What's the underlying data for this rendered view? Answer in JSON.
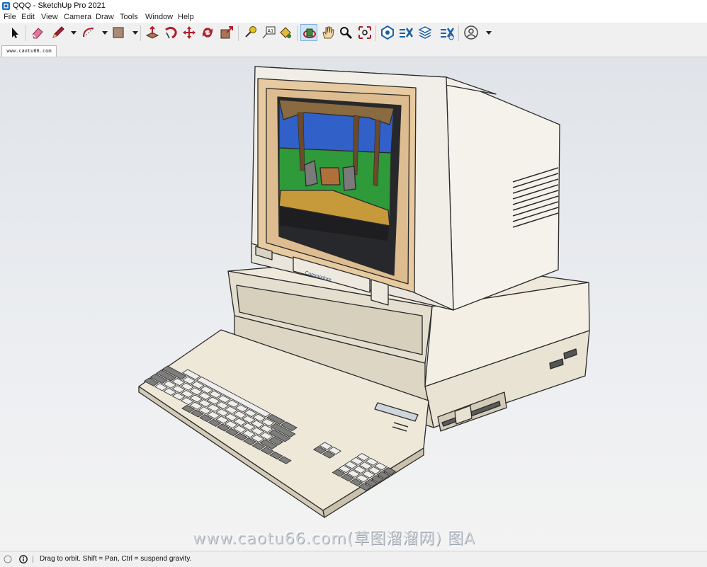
{
  "window": {
    "title": "QQQ - SketchUp Pro 2021"
  },
  "menu": [
    "File",
    "Edit",
    "View",
    "Camera",
    "Draw",
    "Tools",
    "Window",
    "Help"
  ],
  "toolbar": {
    "tools": [
      {
        "name": "select-tool",
        "icon": "arrow-icon"
      },
      {
        "name": "eraser-tool",
        "icon": "eraser-icon"
      },
      {
        "name": "pencil-tool",
        "icon": "pencil-icon"
      },
      {
        "name": "arc-tool",
        "icon": "arc-icon"
      },
      {
        "name": "shape-tool",
        "icon": "rectangle-icon"
      },
      {
        "name": "push-pull-tool",
        "icon": "push-pull-icon"
      },
      {
        "name": "follow-me-tool",
        "icon": "follow-me-icon"
      },
      {
        "name": "move-tool",
        "icon": "move-icon"
      },
      {
        "name": "rotate-tool",
        "icon": "rotate-icon"
      },
      {
        "name": "scale-tool",
        "icon": "scale-icon"
      },
      {
        "name": "tape-measure-tool",
        "icon": "tape-measure-icon"
      },
      {
        "name": "text-tool",
        "icon": "text-icon",
        "label": "A1"
      },
      {
        "name": "paint-bucket-tool",
        "icon": "paint-bucket-icon"
      },
      {
        "name": "orbit-tool",
        "icon": "orbit-icon",
        "active": true
      },
      {
        "name": "pan-tool",
        "icon": "hand-icon"
      },
      {
        "name": "zoom-tool",
        "icon": "magnifier-icon"
      },
      {
        "name": "zoom-extents-tool",
        "icon": "zoom-extents-icon"
      },
      {
        "name": "warehouse-tool",
        "icon": "warehouse-icon"
      },
      {
        "name": "extension-warehouse-tool",
        "icon": "extension-icon"
      },
      {
        "name": "layout-tool",
        "icon": "layers-icon"
      },
      {
        "name": "extension-manager-tool",
        "icon": "extension-manager-icon"
      },
      {
        "name": "account-tool",
        "icon": "account-icon"
      }
    ]
  },
  "scene_tab": {
    "label": "www.caotu66.com"
  },
  "model": {
    "description": "Commodore personal computer 3D model",
    "monitor_brand": "Commodore",
    "colors": {
      "case": "#ebe5d7",
      "case_shadow": "#d6cfbd",
      "bezel": "#e6c89a",
      "screen": "#2a2c30",
      "key_light": "#eeeeee",
      "key_dark": "#7d7d7d"
    }
  },
  "watermark": {
    "text": "www.caotu66.com(草图溜溜网) 图A"
  },
  "status": {
    "message": "Drag to orbit. Shift = Pan, Ctrl = suspend gravity."
  }
}
